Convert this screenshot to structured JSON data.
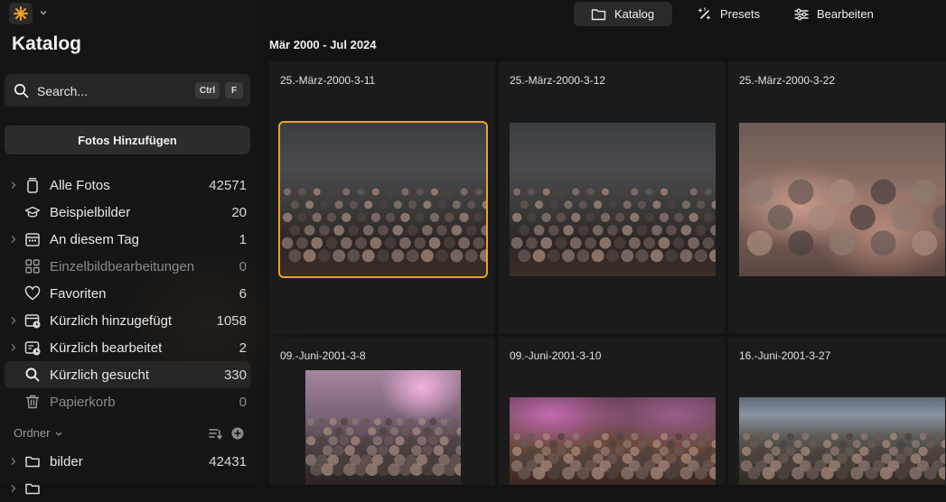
{
  "app": {
    "accent": "#f0a020"
  },
  "sidebar": {
    "title": "Katalog",
    "search": {
      "placeholder": "Search...",
      "kbd1": "Ctrl",
      "kbd2": "F"
    },
    "add_button": "Fotos Hinzufügen",
    "items": [
      {
        "label": "Alle Fotos",
        "count": "42571",
        "icon": "photos-stack-icon",
        "expandable": true,
        "dim": false,
        "active": false
      },
      {
        "label": "Beispielbilder",
        "count": "20",
        "icon": "graduation-cap-icon",
        "expandable": false,
        "dim": false,
        "active": false
      },
      {
        "label": "An diesem Tag",
        "count": "1",
        "icon": "calendar-icon",
        "expandable": true,
        "dim": false,
        "active": false
      },
      {
        "label": "Einzelbildbearbeitungen",
        "count": "0",
        "icon": "grid-icon",
        "expandable": false,
        "dim": true,
        "active": false
      },
      {
        "label": "Favoriten",
        "count": "6",
        "icon": "heart-icon",
        "expandable": false,
        "dim": false,
        "active": false
      },
      {
        "label": "Kürzlich hinzugefügt",
        "count": "1058",
        "icon": "recently-added-icon",
        "expandable": true,
        "dim": false,
        "active": false
      },
      {
        "label": "Kürzlich bearbeitet",
        "count": "2",
        "icon": "recently-edited-icon",
        "expandable": true,
        "dim": false,
        "active": false
      },
      {
        "label": "Kürzlich gesucht",
        "count": "330",
        "icon": "search-icon",
        "expandable": false,
        "dim": false,
        "active": true
      },
      {
        "label": "Papierkorb",
        "count": "0",
        "icon": "trash-icon",
        "expandable": false,
        "dim": true,
        "active": false
      }
    ],
    "folders_label": "Ordner",
    "folders": [
      {
        "label": "bilder",
        "count": "42431"
      }
    ]
  },
  "topbar": {
    "katalog": "Katalog",
    "presets": "Presets",
    "bearbeiten": "Bearbeiten"
  },
  "main": {
    "date_range": "Mär 2000 - Jul 2024",
    "photos": [
      {
        "name": "25.-März-2000-3-11",
        "selected": true
      },
      {
        "name": "25.-März-2000-3-12",
        "selected": false
      },
      {
        "name": "25.-März-2000-3-22",
        "selected": false
      },
      {
        "name": "09.-Juni-2001-3-8",
        "selected": false
      },
      {
        "name": "09.-Juni-2001-3-10",
        "selected": false
      },
      {
        "name": "16.-Juni-2001-3-27",
        "selected": false
      }
    ]
  }
}
